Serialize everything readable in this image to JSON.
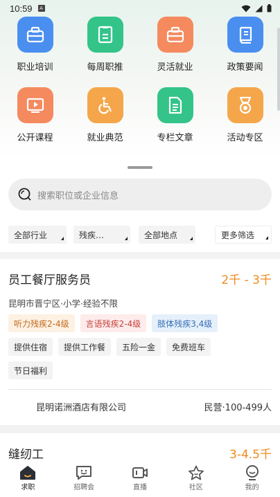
{
  "status": {
    "time": "10:59",
    "notif_glyph": "A"
  },
  "grid": [
    {
      "label": "职业培训",
      "icon": "briefcase-icon",
      "color": "#4a8ff0"
    },
    {
      "label": "每周职推",
      "icon": "clipboard-icon",
      "color": "#34c489"
    },
    {
      "label": "灵活就业",
      "icon": "briefcase-icon",
      "color": "#f58a5f"
    },
    {
      "label": "政策要闻",
      "icon": "book-icon",
      "color": "#4a8ff0"
    },
    {
      "label": "公开课程",
      "icon": "video-play-icon",
      "color": "#f58a5f"
    },
    {
      "label": "就业典范",
      "icon": "wheelchair-icon",
      "color": "#f5a64a"
    },
    {
      "label": "专栏文章",
      "icon": "document-icon",
      "color": "#34c489"
    },
    {
      "label": "活动专区",
      "icon": "medal-icon",
      "color": "#f5a64a"
    }
  ],
  "search": {
    "placeholder": "搜索职位或企业信息"
  },
  "filters": [
    "全部行业",
    "残疾…",
    "全部地点",
    "更多筛选"
  ],
  "job": {
    "title": "员工餐厅服务员",
    "salary": "2千 - 3千",
    "meta": "昆明市晋宁区·小学·经验不限",
    "tags_colored": [
      "听力残疾2-4级",
      "言语残疾2-4级",
      "肢体残疾3,4级"
    ],
    "tags_benefits_row1": [
      "提供住宿",
      "提供工作餐",
      "五险一金",
      "免费班车"
    ],
    "tags_benefits_row2": [
      "节日福利"
    ],
    "company": "昆明诺洲酒店有限公司",
    "company_info": "民营·100-499人"
  },
  "job2": {
    "title": "缝纫工",
    "salary": "3-4.5千"
  },
  "tabs": [
    {
      "label": "求职",
      "icon": "home-icon"
    },
    {
      "label": "招聘会",
      "icon": "chat-smile-icon"
    },
    {
      "label": "直播",
      "icon": "video-camera-icon"
    },
    {
      "label": "社区",
      "icon": "star-face-icon"
    },
    {
      "label": "我的",
      "icon": "profile-icon"
    }
  ]
}
